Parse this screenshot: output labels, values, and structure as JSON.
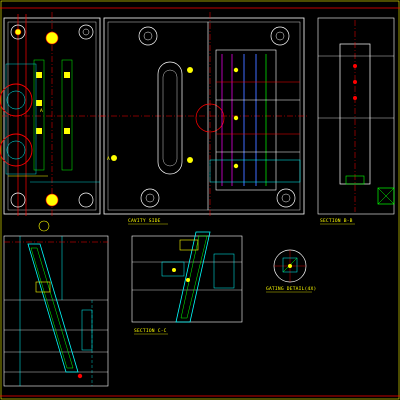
{
  "drawing": {
    "background": "#000000",
    "colors": {
      "outline": "#ffffff",
      "frame": "#ff0000",
      "centerline": "#ff0000",
      "hatch": "#00ffff",
      "accent_yellow": "#ffff00",
      "accent_green": "#00ff00",
      "accent_magenta": "#ff00ff",
      "accent_blue": "#3f6bff"
    },
    "labels": {
      "cavity_side": "CAVITY SIDE",
      "section_bb": "SECTION B-B",
      "section_cc": "SECTION C-C",
      "gating_detail": "GATING DETAIL(4X)",
      "mark_a_left": "A",
      "mark_a_right": "A"
    }
  }
}
